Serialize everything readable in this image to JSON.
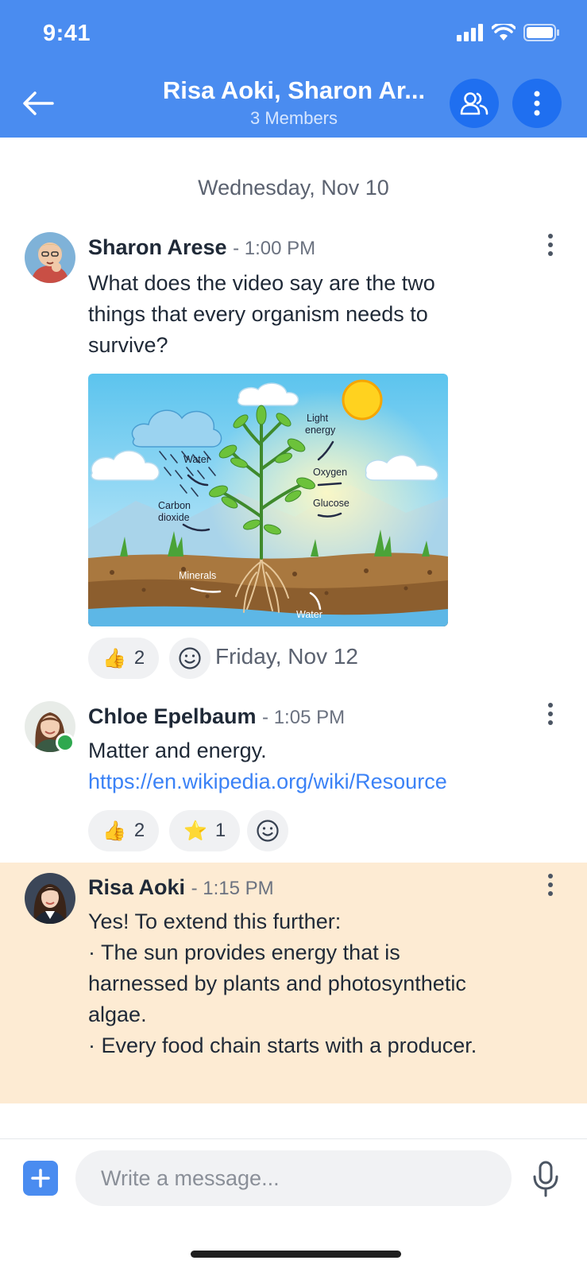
{
  "status": {
    "time": "9:41"
  },
  "header": {
    "title": "Risa Aoki, Sharon Ar...",
    "subtitle": "3 Members"
  },
  "date_divider": "Wednesday, Nov 10",
  "floating_date": "Friday, Nov 12",
  "messages": [
    {
      "sender": "Sharon Arese",
      "time": "- 1:00 PM",
      "lines": [
        "What does the video say are the two",
        "things that every organism needs to",
        "survive?"
      ],
      "reactions": [
        {
          "emoji": "👍",
          "count": "2"
        }
      ],
      "image_labels": {
        "light_energy_1": "Light",
        "light_energy_2": "energy",
        "water_top": "Water",
        "oxygen": "Oxygen",
        "carbon_1": "Carbon",
        "carbon_2": "dioxide",
        "glucose": "Glucose",
        "minerals": "Minerals",
        "water_bottom": "Water"
      }
    },
    {
      "sender": "Chloe Epelbaum",
      "time": "- 1:05 PM",
      "lines": [
        "Matter and energy."
      ],
      "link": "https://en.wikipedia.org/wiki/Resource",
      "reactions": [
        {
          "emoji": "👍",
          "count": "2"
        },
        {
          "emoji": "⭐",
          "count": "1"
        }
      ]
    },
    {
      "sender": "Risa Aoki",
      "time": "- 1:15 PM",
      "lines": [
        "Yes! To extend this further:",
        "· The sun provides energy that is",
        "harnessed by plants and photosynthetic",
        "algae.",
        "· Every food chain starts with a producer."
      ]
    }
  ],
  "composer": {
    "placeholder": "Write a message..."
  },
  "colors": {
    "header_bg": "#4a8cf0",
    "header_button": "#1f6ff0",
    "link": "#3b82f6",
    "highlight_bg": "#fdebd3",
    "online": "#2fa84f"
  },
  "icons": [
    "back-arrow-icon",
    "members-icon",
    "more-vertical-icon",
    "add-reaction-icon",
    "plus-icon",
    "microphone-icon"
  ]
}
